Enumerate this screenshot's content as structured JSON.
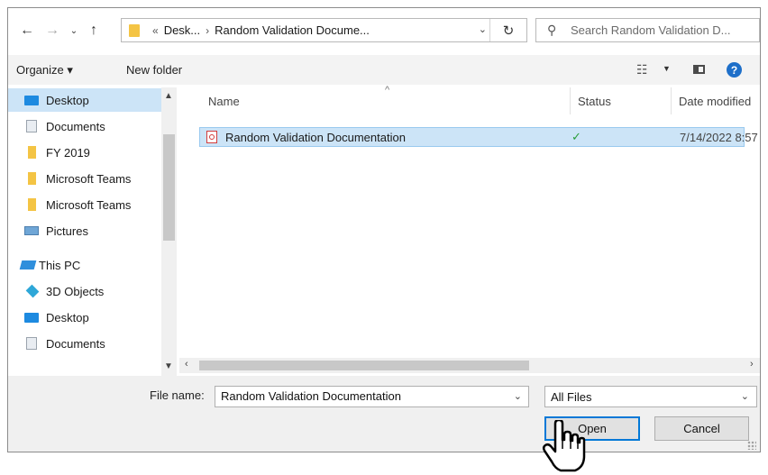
{
  "nav": {
    "back_icon": "back-arrow-icon",
    "forward_icon": "forward-arrow-icon",
    "recent_icon": "chevron-down-icon",
    "up_icon": "up-arrow-icon"
  },
  "address": {
    "overflow": "«",
    "crumbs": [
      "Desk...",
      "Random Validation Docume..."
    ],
    "separator": "›"
  },
  "search": {
    "placeholder": "Search Random Validation D..."
  },
  "commandbar": {
    "organize": "Organize ▾",
    "new_folder": "New folder"
  },
  "sidebar": {
    "items": [
      {
        "label": "Desktop",
        "icon": "desktop-icon",
        "selected": true
      },
      {
        "label": "Documents",
        "icon": "documents-icon"
      },
      {
        "label": "FY 2019",
        "icon": "folder-icon"
      },
      {
        "label": "Microsoft Teams",
        "icon": "folder-icon"
      },
      {
        "label": "Microsoft Teams",
        "icon": "folder-icon"
      },
      {
        "label": "Pictures",
        "icon": "pictures-icon"
      },
      {
        "label": "This PC",
        "icon": "this-pc-icon"
      },
      {
        "label": "3D Objects",
        "icon": "3d-objects-icon"
      },
      {
        "label": "Desktop",
        "icon": "desktop-icon"
      },
      {
        "label": "Documents",
        "icon": "documents-icon"
      }
    ]
  },
  "filelist": {
    "columns": [
      "Name",
      "Status",
      "Date modified"
    ],
    "rows": [
      {
        "name": "Random Validation Documentation",
        "status": "✓",
        "date": "7/14/2022 8:57",
        "icon": "pdf-file-icon",
        "selected": true
      }
    ]
  },
  "footer": {
    "file_name_label": "File name:",
    "file_name_value": "Random Validation Documentation",
    "file_type": "All Files",
    "open_label": "Open",
    "cancel_label": "Cancel"
  },
  "colors": {
    "selection": "#cce4f7",
    "accent": "#0078d7",
    "folder": "#f4c444"
  }
}
